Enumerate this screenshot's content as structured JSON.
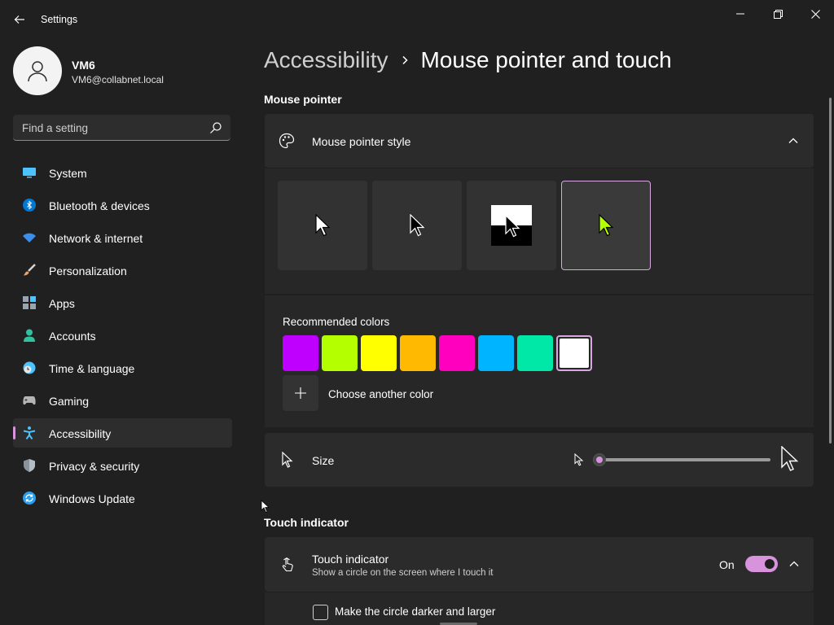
{
  "window": {
    "title": "Settings"
  },
  "profile": {
    "name": "VM6",
    "email": "VM6@collabnet.local"
  },
  "search": {
    "placeholder": "Find a setting"
  },
  "nav": {
    "items": [
      {
        "label": "System",
        "icon": "system-icon",
        "color": "#4cc2ff"
      },
      {
        "label": "Bluetooth & devices",
        "icon": "bluetooth-icon",
        "color": "#0078d4"
      },
      {
        "label": "Network & internet",
        "icon": "wifi-icon",
        "color": "#3b8eea"
      },
      {
        "label": "Personalization",
        "icon": "brush-icon",
        "color": "#e8a26c"
      },
      {
        "label": "Apps",
        "icon": "apps-icon",
        "color": "#9aa4b0"
      },
      {
        "label": "Accounts",
        "icon": "accounts-icon",
        "color": "#2fc2a1"
      },
      {
        "label": "Time & language",
        "icon": "globe-clock-icon",
        "color": "#4cc2ff"
      },
      {
        "label": "Gaming",
        "icon": "gamepad-icon",
        "color": "#b4b4b4"
      },
      {
        "label": "Accessibility",
        "icon": "accessibility-icon",
        "color": "#4cc2ff",
        "active": true
      },
      {
        "label": "Privacy & security",
        "icon": "shield-icon",
        "color": "#9aa4b0"
      },
      {
        "label": "Windows Update",
        "icon": "update-icon",
        "color": "#2a9ff0"
      }
    ]
  },
  "breadcrumb": {
    "parent": "Accessibility",
    "current": "Mouse pointer and touch"
  },
  "mouse_pointer": {
    "section_title": "Mouse pointer",
    "style_label": "Mouse pointer style",
    "styles": [
      "white",
      "black",
      "inverted",
      "custom"
    ],
    "selected_style": "custom",
    "custom_color": "#b4ff00",
    "recommended_label": "Recommended colors",
    "colors": [
      "#c000ff",
      "#b4ff00",
      "#ffff00",
      "#ffb900",
      "#ff00bf",
      "#00b4ff",
      "#00e8a8",
      "#ffffff"
    ],
    "selected_color_index": 7,
    "choose_color_label": "Choose another color",
    "size_label": "Size",
    "size_value": 1
  },
  "touch": {
    "section_title": "Touch indicator",
    "label": "Touch indicator",
    "description": "Show a circle on the screen where I touch it",
    "toggle_state": "On",
    "darker_label": "Make the circle darker and larger"
  },
  "accent_color": "#d793dc"
}
